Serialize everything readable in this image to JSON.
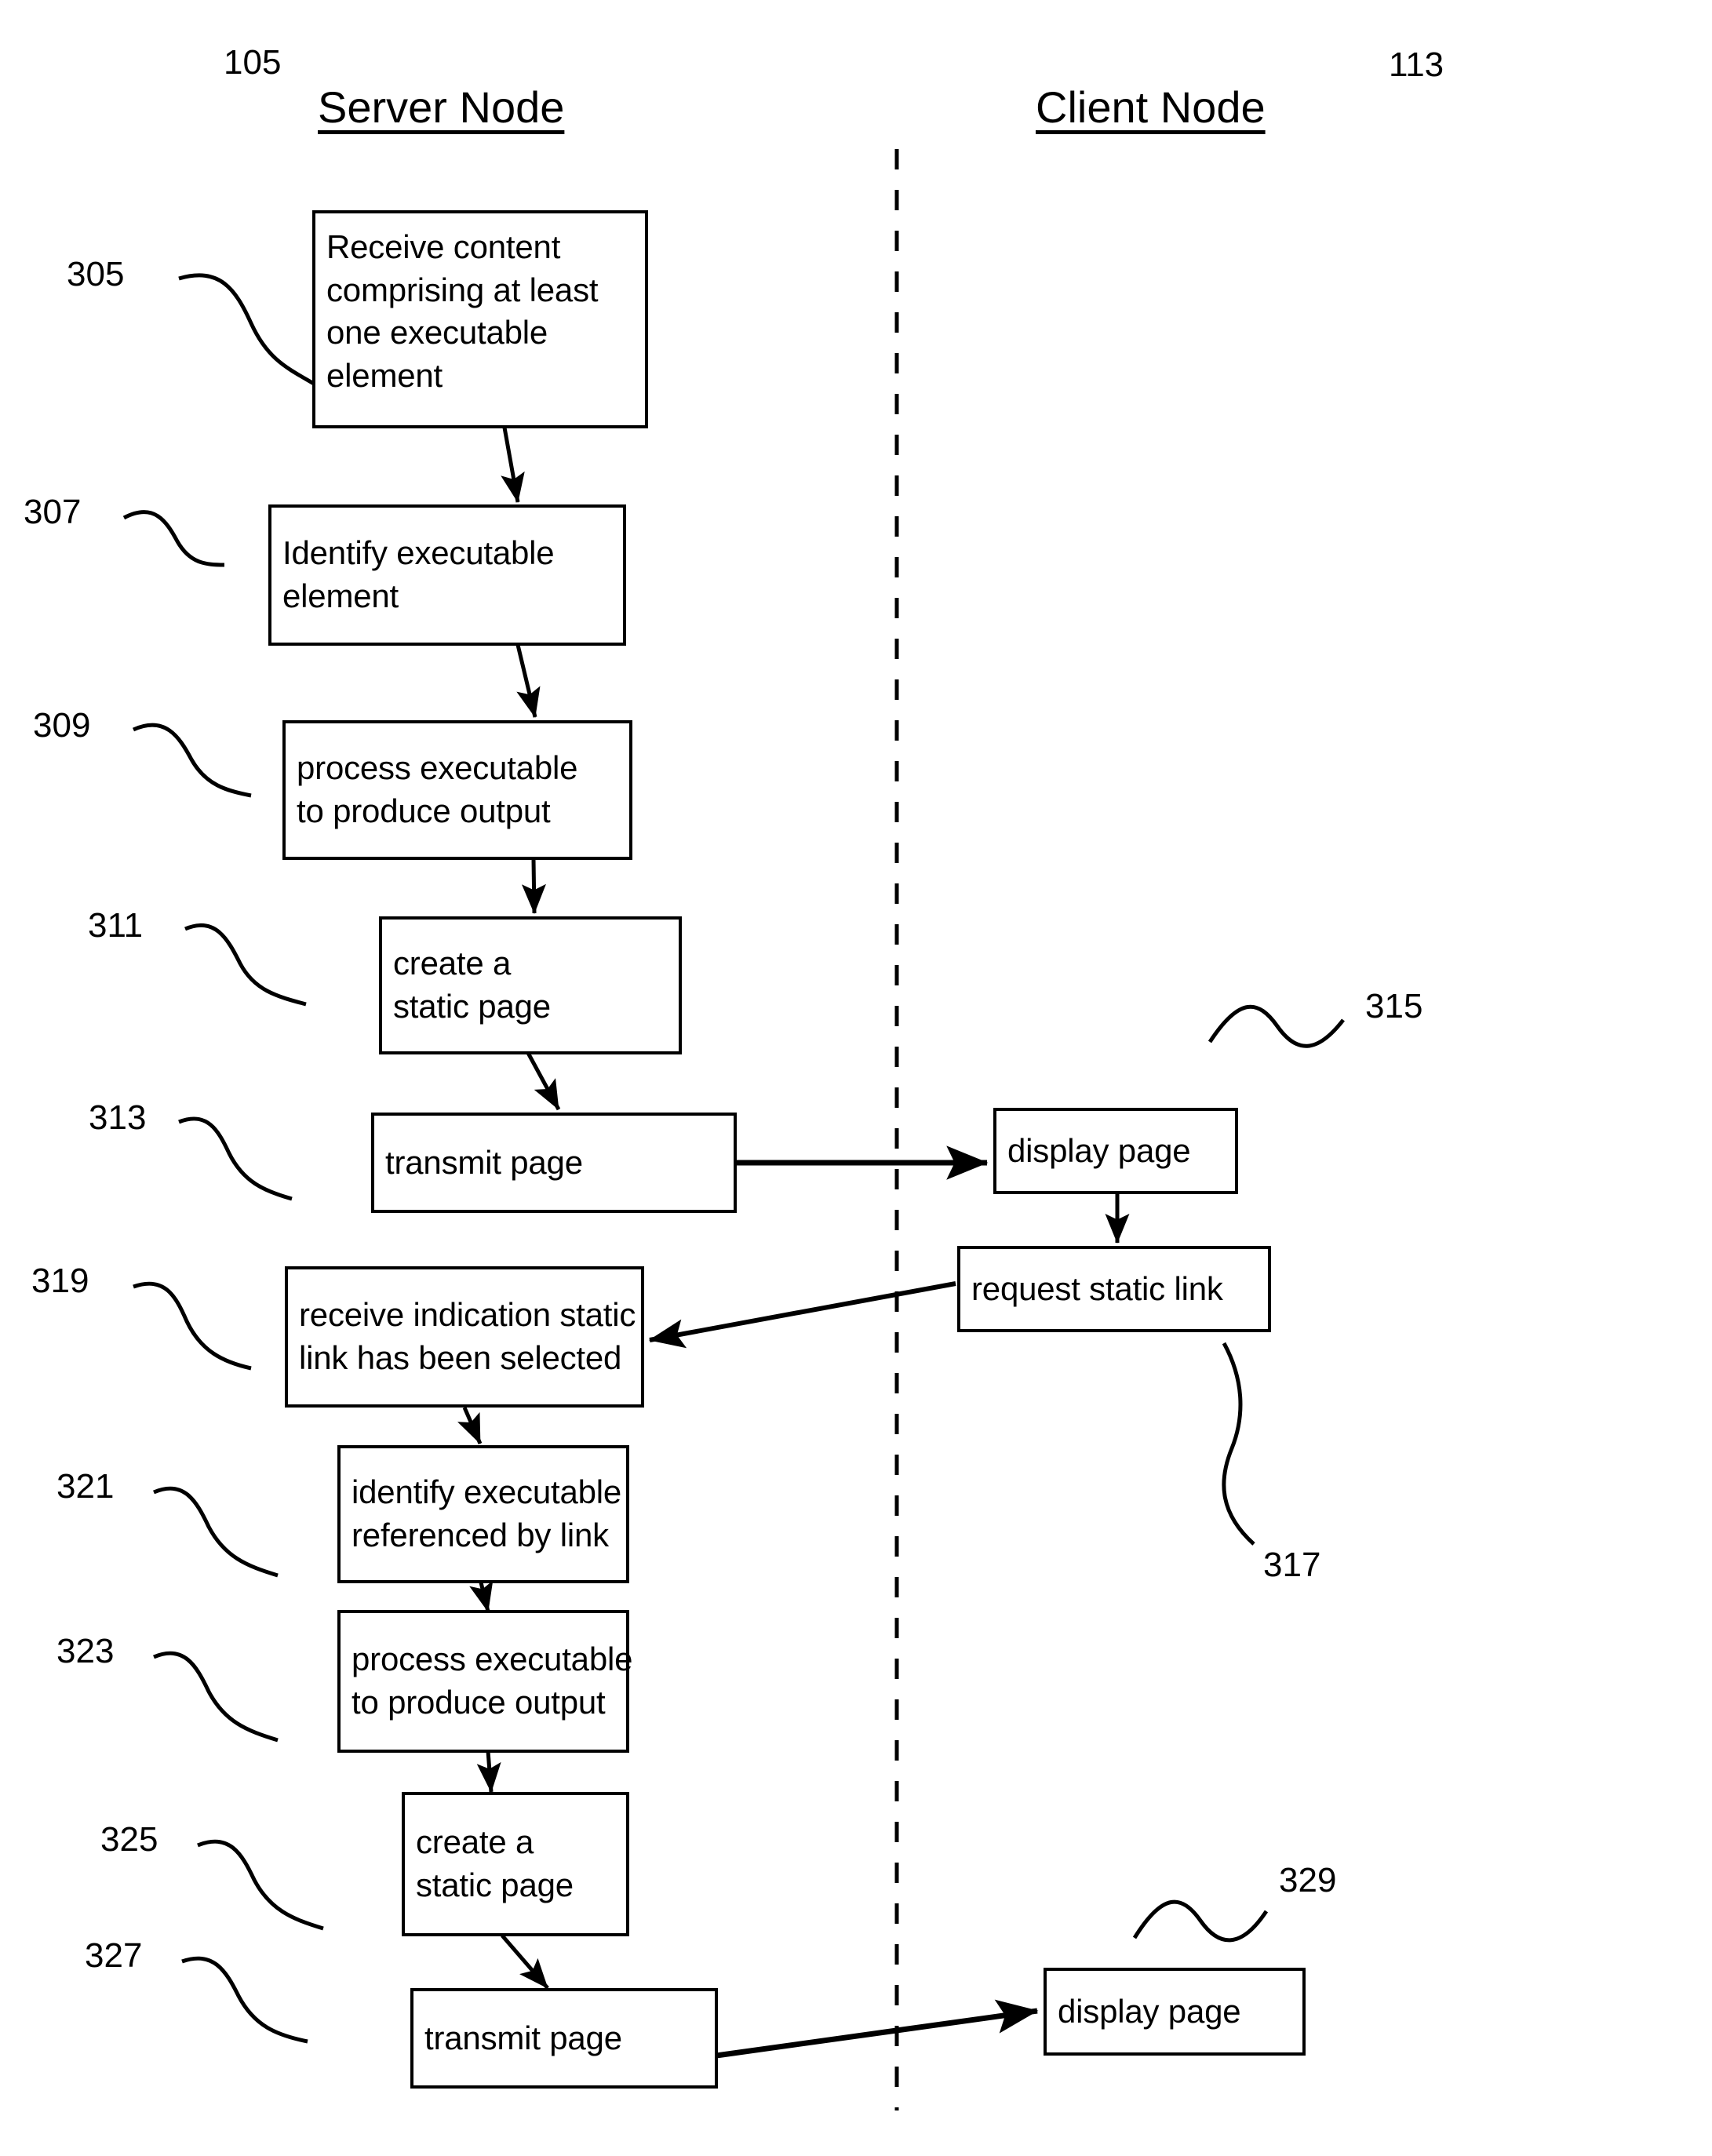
{
  "figure": {
    "type": "patent-flowchart",
    "columns": [
      {
        "title": "Server Node",
        "ref": "105"
      },
      {
        "title": "Client Node",
        "ref": "113"
      }
    ],
    "divider": "vertical-dashed-line"
  },
  "nodes": [
    {
      "ref": "305",
      "column": "server",
      "lines": [
        "Receive content",
        "comprising at least",
        "one executable",
        "element"
      ]
    },
    {
      "ref": "307",
      "column": "server",
      "lines": [
        "Identify executable",
        "element"
      ]
    },
    {
      "ref": "309",
      "column": "server",
      "lines": [
        "process executable",
        "to produce output"
      ]
    },
    {
      "ref": "311",
      "column": "server",
      "lines": [
        "create a",
        "static page"
      ]
    },
    {
      "ref": "313",
      "column": "server",
      "lines": [
        "transmit page"
      ]
    },
    {
      "ref": "315",
      "column": "client",
      "lines": [
        "display page"
      ]
    },
    {
      "ref": "317",
      "column": "client",
      "lines": [
        "request static link"
      ]
    },
    {
      "ref": "319",
      "column": "server",
      "lines": [
        "receive indication static",
        "link has been selected"
      ]
    },
    {
      "ref": "321",
      "column": "server",
      "lines": [
        "identify executable",
        "referenced by link"
      ]
    },
    {
      "ref": "323",
      "column": "server",
      "lines": [
        "process executable",
        "to produce output"
      ]
    },
    {
      "ref": "325",
      "column": "server",
      "lines": [
        "create a",
        "static page"
      ]
    },
    {
      "ref": "327",
      "column": "server",
      "lines": [
        "transmit page"
      ]
    },
    {
      "ref": "329",
      "column": "client",
      "lines": [
        "display page"
      ]
    }
  ],
  "edges": [
    {
      "from": "305",
      "to": "307"
    },
    {
      "from": "307",
      "to": "309"
    },
    {
      "from": "309",
      "to": "311"
    },
    {
      "from": "311",
      "to": "313"
    },
    {
      "from": "313",
      "to": "315"
    },
    {
      "from": "315",
      "to": "317"
    },
    {
      "from": "317",
      "to": "319"
    },
    {
      "from": "319",
      "to": "321"
    },
    {
      "from": "321",
      "to": "323"
    },
    {
      "from": "323",
      "to": "325"
    },
    {
      "from": "325",
      "to": "327"
    },
    {
      "from": "327",
      "to": "329"
    }
  ],
  "colors": {
    "ink": "#000000",
    "paper": "#ffffff"
  }
}
